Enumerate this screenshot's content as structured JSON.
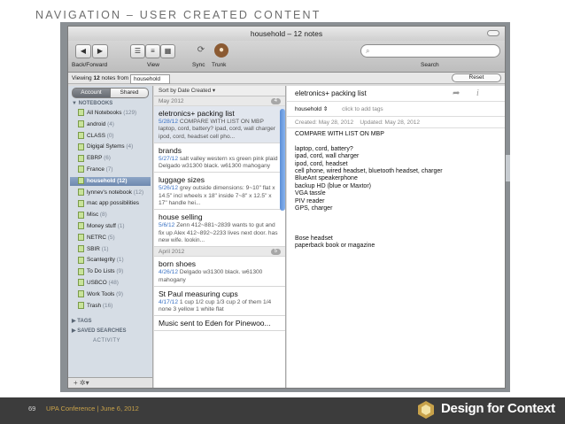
{
  "slide": {
    "title": "NAVIGATION – USER CREATED CONTENT",
    "slide_number": "69",
    "conference": "UPA Conference  |  June 6, 2012",
    "brand": "Design for Context",
    "colors": {
      "accent": "#c8a24a",
      "footer": "#3c3c3c"
    }
  },
  "window": {
    "title": "household – 12 notes"
  },
  "toolbar": {
    "back_forward_label": "Back/Forward",
    "view_label": "View",
    "sync_label": "Sync",
    "trunk_label": "Trunk",
    "search_label": "Search",
    "back_icon": "◀",
    "forward_icon": "▶"
  },
  "viewbar": {
    "prefix": "Viewing",
    "count": "12",
    "middle": "notes from",
    "notebook": "household",
    "reset_label": "Reset"
  },
  "sidebar": {
    "account_label": "Account",
    "shared_label": "Shared",
    "notebooks_header": "▼ NOTEBOOKS",
    "notebooks": [
      {
        "label": "All Notebooks",
        "count": "(129)"
      },
      {
        "label": "android",
        "count": "(4)"
      },
      {
        "label": "CLASS",
        "count": "(0)"
      },
      {
        "label": "Digigal Sytems",
        "count": "(4)"
      },
      {
        "label": "EBRP",
        "count": "(6)"
      },
      {
        "label": "France",
        "count": "(7)"
      },
      {
        "label": "household",
        "count": "(12)"
      },
      {
        "label": "lynnev's notebook",
        "count": "(12)"
      },
      {
        "label": "mac app possibilities",
        "count": ""
      },
      {
        "label": "Misc",
        "count": "(8)"
      },
      {
        "label": "Money stuff",
        "count": "(1)"
      },
      {
        "label": "NETRC",
        "count": "(5)"
      },
      {
        "label": "SBIR",
        "count": "(1)"
      },
      {
        "label": "Scantegrity",
        "count": "(1)"
      },
      {
        "label": "To Do Lists",
        "count": "(9)"
      },
      {
        "label": "USBCO",
        "count": "(48)"
      },
      {
        "label": "Work Tools",
        "count": "(9)"
      },
      {
        "label": "Trash",
        "count": "(16)"
      }
    ],
    "tags_header": "▶ TAGS",
    "saved_searches_header": "▶ SAVED SEARCHES",
    "activity_label": "ACTIVITY",
    "bottom_controls": "+  ✲▾"
  },
  "notelist": {
    "sort_label": "Sort by Date Created ▾",
    "groups": [
      {
        "month": "May 2012",
        "count": "4",
        "notes": [
          {
            "title": "eletronics+ packing list",
            "date": "5/28/12",
            "snippet": "COMPARE WITH LIST ON MBP laptop, cord, battery? ipad, cord, wall charger ipod, cord, headset cell pho..."
          },
          {
            "title": "brands",
            "date": "5/27/12",
            "snippet": "salt valley western xs green pink plaid Delgado w31300 black. w61300 mahogany"
          },
          {
            "title": "luggage sizes",
            "date": "5/26/12",
            "snippet": "grey outside dimensions: 9~10\" flat x 14.5\" incl wheels x 18\" inside 7~8\" x 12.5\" x 17\" handle hei..."
          },
          {
            "title": "house selling",
            "date": "5/6/12",
            "snippet": "Zenn 412~881~2839 wants to gut and fix up Alex 412~892~2233 lives next door. has new wife. lookin..."
          }
        ]
      },
      {
        "month": "April 2012",
        "count": "5",
        "notes": [
          {
            "title": "born shoes",
            "date": "4/26/12",
            "snippet": "Delgado w31300 black. w61300 mahogany"
          },
          {
            "title": "St Paul measuring cups",
            "date": "4/17/12",
            "snippet": "1 cup 1/2 cup 1/3 cup 2 of them 1/4 none 3 yellow 1 white flat"
          },
          {
            "title": "Music sent to Eden for Pinewoo...",
            "date": "",
            "snippet": ""
          }
        ]
      }
    ]
  },
  "editor": {
    "title": "eletronics+ packing list",
    "notebook": "household",
    "tags_placeholder": "click to add tags",
    "created": "Created: May 28, 2012",
    "updated": "Updated: May 28, 2012",
    "body_lines": [
      "COMPARE WITH LIST ON MBP",
      "",
      "laptop, cord, battery?",
      "ipad, cord, wall charger",
      "ipod, cord, headset",
      "cell phone, wired headset, bluetooth headset, charger",
      "BlueAnt speakerphone",
      "backup HD (blue or Maxtor)",
      "VGA tassle",
      "PIV reader",
      "GPS, charger",
      "",
      "",
      "",
      "Bose headset",
      "paperback book or magazine"
    ]
  }
}
